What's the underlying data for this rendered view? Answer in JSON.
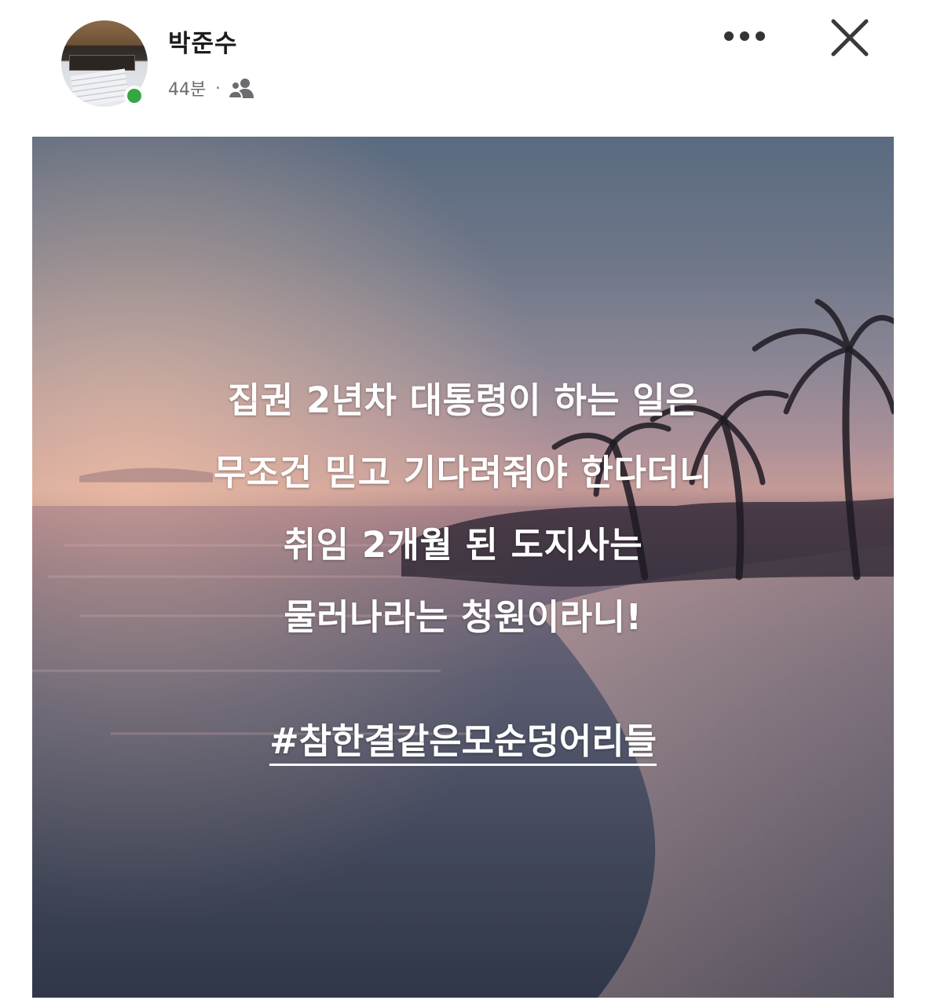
{
  "post": {
    "author_name": "박준수",
    "time_ago": "44분",
    "meta_separator": "·",
    "privacy_icon": "friends-icon",
    "online_status_color": "#34a742",
    "more_icon": "more-dots-icon",
    "close_icon": "close-icon"
  },
  "image": {
    "lines": [
      "집권 2년차 대통령이 하는 일은",
      "무조건 믿고 기다려줘야 한다더니",
      "취임 2개월 된 도지사는",
      "물러나라는 청원이라니!"
    ],
    "hashtag": "#참한결같은모순덩어리들"
  }
}
